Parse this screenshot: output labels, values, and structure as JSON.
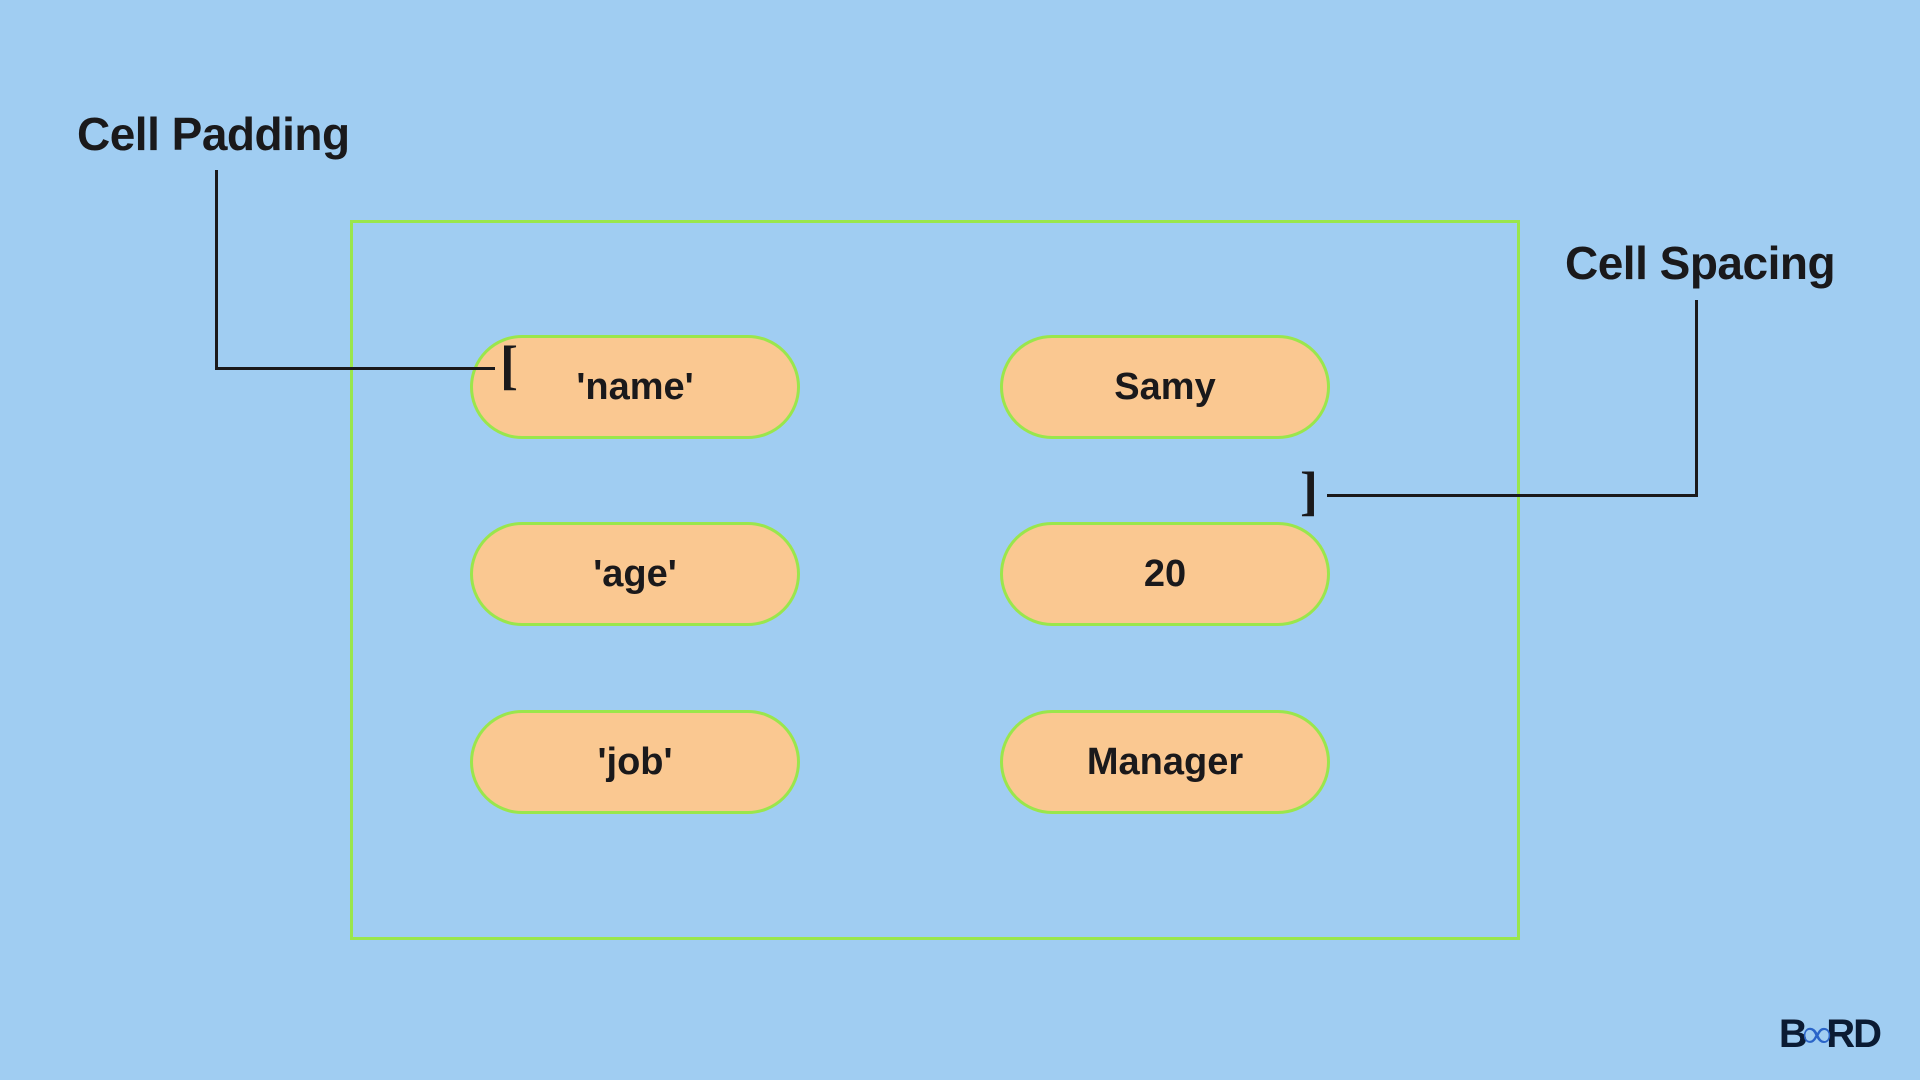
{
  "labels": {
    "cell_padding": "Cell Padding",
    "cell_spacing": "Cell Spacing"
  },
  "cells": {
    "r1c1": "'name'",
    "r1c2": "Samy",
    "r2c1": "'age'",
    "r2c2": "20",
    "r3c1": "'job'",
    "r3c2": "Manager"
  },
  "brackets": {
    "left": "[",
    "right": "]"
  },
  "logo": {
    "part1": "B",
    "infinity": "∞",
    "part2": "RD"
  },
  "colors": {
    "background": "#a0cdf2",
    "cell_fill": "#fac891",
    "cell_border": "#9ae64c",
    "text": "#1a191b"
  }
}
